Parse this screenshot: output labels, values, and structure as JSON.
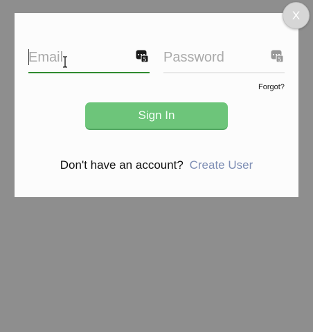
{
  "close_button": {
    "label": "X"
  },
  "login_form": {
    "email": {
      "placeholder": "Email",
      "value": "",
      "icon": "password-manager-icon"
    },
    "password": {
      "placeholder": "Password",
      "value": "",
      "icon": "password-manager-icon"
    },
    "forgot_label": "Forgot?",
    "sign_in_label": "Sign In",
    "signup_prompt": "Don't have an account?",
    "create_user_label": "Create User"
  },
  "colors": {
    "overlay": "#8e8e8e",
    "modal_bg": "#fcfcfc",
    "sign_in_button": "#6dc57a",
    "active_underline": "#2f8a2f",
    "link": "#7f8fb5"
  }
}
